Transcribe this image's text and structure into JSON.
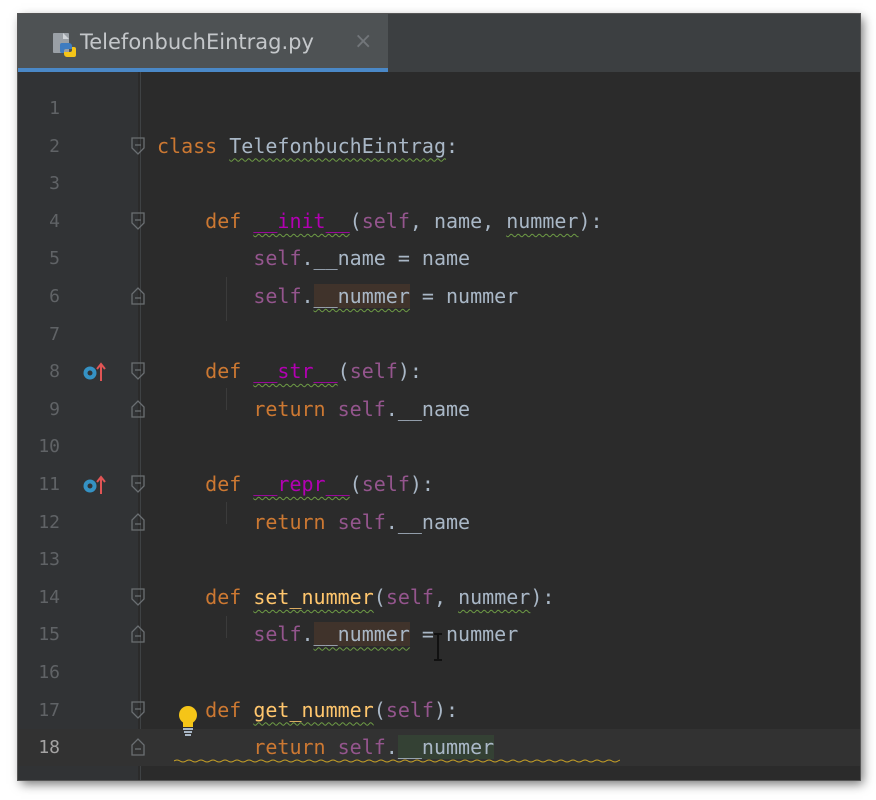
{
  "tab": {
    "title": "TelefonbuchEintrag.py",
    "close_glyph": "×",
    "file_icon": "python-file-icon"
  },
  "editor": {
    "current_line": 18,
    "lines": [
      {
        "num": "1",
        "indent": "",
        "tokens": []
      },
      {
        "num": "2",
        "indent": "",
        "tokens": [
          [
            "kw",
            "class"
          ],
          [
            "t",
            " "
          ],
          [
            "warn",
            "TelefonbuchEintrag"
          ],
          [
            "t",
            ":"
          ]
        ]
      },
      {
        "num": "3",
        "indent": "",
        "tokens": []
      },
      {
        "num": "4",
        "indent": "    ",
        "tokens": [
          [
            "kw",
            "def"
          ],
          [
            "t",
            " "
          ],
          [
            "magic-warn",
            "__init__"
          ],
          [
            "t",
            "("
          ],
          [
            "self",
            "self"
          ],
          [
            "t",
            ", name, "
          ],
          [
            "warn",
            "nummer"
          ],
          [
            "t",
            "):"
          ]
        ]
      },
      {
        "num": "5",
        "indent": "        ",
        "tokens": [
          [
            "self",
            "self"
          ],
          [
            "t",
            ".__name = name"
          ]
        ]
      },
      {
        "num": "6",
        "indent": "        ",
        "tokens": [
          [
            "self",
            "self"
          ],
          [
            "t",
            "."
          ],
          [
            "warn-write",
            "__nummer"
          ],
          [
            "t",
            " = nummer"
          ]
        ]
      },
      {
        "num": "7",
        "indent": "",
        "tokens": []
      },
      {
        "num": "8",
        "indent": "    ",
        "tokens": [
          [
            "kw",
            "def"
          ],
          [
            "t",
            " "
          ],
          [
            "magic-warn",
            "__str__"
          ],
          [
            "t",
            "("
          ],
          [
            "self",
            "self"
          ],
          [
            "t",
            "):"
          ]
        ]
      },
      {
        "num": "9",
        "indent": "        ",
        "tokens": [
          [
            "kw",
            "return"
          ],
          [
            "t",
            " "
          ],
          [
            "self",
            "self"
          ],
          [
            "t",
            ".__name"
          ]
        ]
      },
      {
        "num": "10",
        "indent": "",
        "tokens": []
      },
      {
        "num": "11",
        "indent": "    ",
        "tokens": [
          [
            "kw",
            "def"
          ],
          [
            "t",
            " "
          ],
          [
            "magic-warn",
            "__repr__"
          ],
          [
            "t",
            "("
          ],
          [
            "self",
            "self"
          ],
          [
            "t",
            "):"
          ]
        ]
      },
      {
        "num": "12",
        "indent": "        ",
        "tokens": [
          [
            "kw",
            "return"
          ],
          [
            "t",
            " "
          ],
          [
            "self",
            "self"
          ],
          [
            "t",
            ".__name"
          ]
        ]
      },
      {
        "num": "13",
        "indent": "",
        "tokens": []
      },
      {
        "num": "14",
        "indent": "    ",
        "tokens": [
          [
            "kw",
            "def"
          ],
          [
            "t",
            " "
          ],
          [
            "fn-warn",
            "set_nummer"
          ],
          [
            "t",
            "("
          ],
          [
            "self",
            "self"
          ],
          [
            "t",
            ", "
          ],
          [
            "warn",
            "nummer"
          ],
          [
            "t",
            "):"
          ]
        ]
      },
      {
        "num": "15",
        "indent": "        ",
        "tokens": [
          [
            "self",
            "self"
          ],
          [
            "t",
            "."
          ],
          [
            "warn-write",
            "__nummer"
          ],
          [
            "t",
            " = nummer"
          ]
        ]
      },
      {
        "num": "16",
        "indent": "",
        "tokens": []
      },
      {
        "num": "17",
        "indent": "    ",
        "tokens": [
          [
            "kw",
            "def"
          ],
          [
            "t",
            " "
          ],
          [
            "fn-warn",
            "get_nummer"
          ],
          [
            "t",
            "("
          ],
          [
            "self",
            "self"
          ],
          [
            "t",
            "):"
          ]
        ]
      },
      {
        "num": "18",
        "indent": "        ",
        "tokens": [
          [
            "kw",
            "return"
          ],
          [
            "t",
            " "
          ],
          [
            "self",
            "self"
          ],
          [
            "t",
            "."
          ],
          [
            "read",
            "__nummer"
          ]
        ]
      }
    ],
    "fold_open_lines": [
      2,
      4,
      8,
      11,
      14,
      17
    ],
    "fold_close_lines": [
      6,
      9,
      12,
      15,
      18
    ],
    "override_marker_lines": [
      8,
      11
    ],
    "colors": {
      "background": "#2b2b2b",
      "gutter": "#313335",
      "keyword": "#cc7832",
      "magic": "#b200b2",
      "self": "#94558d",
      "text": "#a9b7c6",
      "function": "#ffc66d",
      "tab_accent": "#4a88c7"
    }
  },
  "intention_bulb": "lightbulb-icon"
}
